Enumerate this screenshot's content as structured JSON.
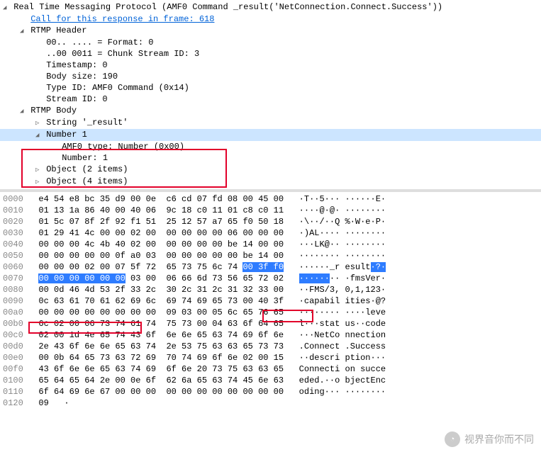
{
  "packet": {
    "title": "Real Time Messaging Protocol (AMF0 Command _result('NetConnection.Connect.Success'))",
    "call_link": "Call for this response in frame: 618",
    "header_label": "RTMP Header",
    "header": {
      "fmt": "00.. .... = Format: 0",
      "csid": "..00 0011 = Chunk Stream ID: 3",
      "timestamp": "Timestamp: 0",
      "bodysize": "Body size: 190",
      "typeid": "Type ID: AMF0 Command (0x14)",
      "streamid": "Stream ID: 0"
    },
    "body_label": "RTMP Body",
    "body": {
      "string": "String '_result'",
      "number_label": "Number 1",
      "number_type": "AMF0 type: Number (0x00)",
      "number_value": "Number: 1",
      "obj2": "Object (2 items)",
      "obj4": "Object (4 items)"
    }
  },
  "hex": {
    "rows": [
      {
        "off": "0000",
        "h": "e4 54 e8 bc 35 d9 00 0e  c6 cd 07 fd 08 00 45 00",
        "a": "·T··5··· ······E·"
      },
      {
        "off": "0010",
        "h": "01 13 1a 86 40 00 40 06  9c 18 c0 11 01 c8 c0 11",
        "a": "····@·@· ········"
      },
      {
        "off": "0020",
        "h": "01 5c 07 8f 2f 92 f1 51  25 12 57 a7 65 f0 50 18",
        "a": "·\\··/··Q %·W·e·P·"
      },
      {
        "off": "0030",
        "h": "01 29 41 4c 00 00 02 00  00 00 00 00 06 00 00 00",
        "a": "·)AL···· ········"
      },
      {
        "off": "0040",
        "h": "00 00 00 4c 4b 40 02 00  00 00 00 00 be 14 00 00",
        "a": "···LK@·· ········"
      },
      {
        "off": "0050",
        "h": "00 00 00 00 00 0f a0 03  00 00 00 00 00 be 14 00",
        "a": "········ ········"
      },
      {
        "off": "0060",
        "h": "00 00 00 02 00 07 5f 72  65 73 75 6c 74 ",
        "a": "······_r esult"
      },
      {
        "off": "0070",
        "h": " 03 00  06 66 6d 73 56 65 72 02",
        "a": "·· ·fmsVer·"
      },
      {
        "off": "0080",
        "h": "00 0d 46 4d 53 2f 33 2c  30 2c 31 2c 31 32 33 00",
        "a": "··FMS/3, 0,1,123·"
      },
      {
        "off": "0090",
        "h": "0c 63 61 70 61 62 69 6c  69 74 69 65 73 00 40 3f",
        "a": "·capabil ities·@?"
      },
      {
        "off": "00a0",
        "h": "00 00 00 00 00 00 00 00  09 03 00 05 6c 65 76 65",
        "a": "········ ····leve"
      },
      {
        "off": "00b0",
        "h": "6c 02 00 06 73 74 61 74  75 73 00 04 63 6f 64 65",
        "a": "l···stat us··code"
      },
      {
        "off": "00c0",
        "h": "02 00 1d 4e 65 74 43 6f  6e 6e 65 63 74 69 6f 6e",
        "a": "···NetCo nnection"
      },
      {
        "off": "00d0",
        "h": "2e 43 6f 6e 6e 65 63 74  2e 53 75 63 63 65 73 73",
        "a": ".Connect .Success"
      },
      {
        "off": "00e0",
        "h": "00 0b 64 65 73 63 72 69  70 74 69 6f 6e 02 00 15",
        "a": "··descri ption···"
      },
      {
        "off": "00f0",
        "h": "43 6f 6e 6e 65 63 74 69  6f 6e 20 73 75 63 63 65",
        "a": "Connecti on succe"
      },
      {
        "off": "0100",
        "h": "65 64 65 64 2e 00 0e 6f  62 6a 65 63 74 45 6e 63",
        "a": "eded.··o bjectEnc"
      },
      {
        "off": "0110",
        "h": "6f 64 69 6e 67 00 00 00  00 00 00 00 00 00 00 00",
        "a": "oding··· ········"
      },
      {
        "off": "0120",
        "h": "09",
        "a": "·"
      }
    ],
    "hl_60_tail_hex": "00 3f f0",
    "hl_60_tail_ascii": "·?·",
    "hl_70_head": "00 00 00 00 00 00",
    "hl_70_ascii_head": "······"
  },
  "watermark": "视界音你而不同"
}
